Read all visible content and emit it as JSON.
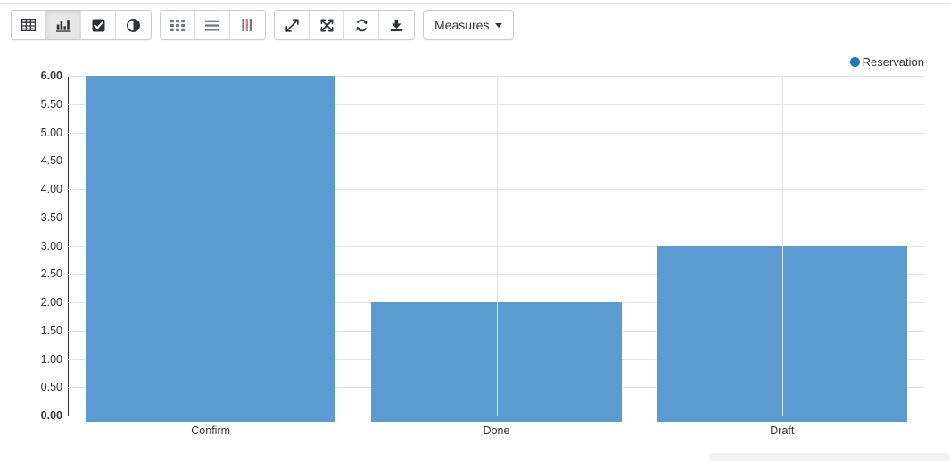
{
  "toolbar": {
    "groups": [
      {
        "name": "view-modes",
        "buttons": [
          {
            "icon": "table-icon",
            "label": "Table view",
            "active": false
          },
          {
            "icon": "bar-chart-icon",
            "label": "Bar chart view",
            "active": true
          },
          {
            "icon": "checkbox-icon",
            "label": "Selection",
            "active": false
          },
          {
            "icon": "contrast-icon",
            "label": "Contrast",
            "active": false
          }
        ]
      },
      {
        "name": "layout-modes",
        "buttons": [
          {
            "icon": "grid-cells-icon",
            "label": "Grid",
            "active": false
          },
          {
            "icon": "align-justify-icon",
            "label": "Horizontal bars",
            "active": false
          },
          {
            "icon": "columns-icon",
            "label": "Vertical bars",
            "active": false
          }
        ]
      },
      {
        "name": "actions",
        "buttons": [
          {
            "icon": "expand-diagonal-icon",
            "label": "Expand",
            "active": false
          },
          {
            "icon": "expand-arrows-icon",
            "label": "Fullscreen",
            "active": false
          },
          {
            "icon": "refresh-icon",
            "label": "Refresh",
            "active": false
          },
          {
            "icon": "download-icon",
            "label": "Download",
            "active": false
          }
        ]
      }
    ],
    "measures": {
      "label": "Measures",
      "caret_icon": "caret-down-icon"
    }
  },
  "chart_data": {
    "type": "bar",
    "title": "",
    "xlabel": "",
    "ylabel": "",
    "categories": [
      "Confirm",
      "Done",
      "Draft"
    ],
    "values": [
      6,
      2,
      3
    ],
    "series": [
      {
        "name": "Reservation",
        "values": [
          6,
          2,
          3
        ],
        "color": "#5b9bd0"
      }
    ],
    "legend": {
      "position": "top-right",
      "entries": [
        {
          "label": "Reservation",
          "color": "#1f79b5",
          "marker": "legend-dot-icon"
        }
      ]
    },
    "ylim": [
      0,
      6
    ],
    "ytick_step": 0.5,
    "ytick_labels": [
      "6.00",
      "5.50",
      "5.00",
      "4.50",
      "4.00",
      "3.50",
      "3.00",
      "2.50",
      "2.00",
      "1.50",
      "1.00",
      "0.50",
      "0.00"
    ],
    "ytick_values": [
      6,
      5.5,
      5,
      4.5,
      4,
      3.5,
      3,
      2.5,
      2,
      1.5,
      1,
      0.5,
      0
    ],
    "bold_ticks": [
      "6.00",
      "0.00"
    ],
    "grid": {
      "horizontal": true,
      "vertical": true
    },
    "bar_color": "#5b9bd0"
  }
}
